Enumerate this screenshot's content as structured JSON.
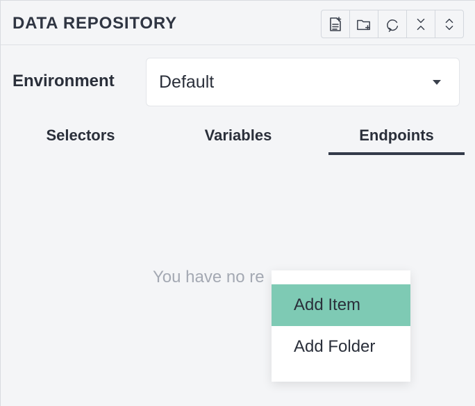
{
  "header": {
    "title": "DATA REPOSITORY",
    "tools": [
      {
        "icon": "new-file-icon"
      },
      {
        "icon": "new-folder-icon"
      },
      {
        "icon": "refresh-icon"
      },
      {
        "icon": "collapse-all-icon"
      },
      {
        "icon": "expand-all-icon"
      }
    ]
  },
  "environment": {
    "label": "Environment",
    "selected": "Default"
  },
  "tabs": [
    {
      "label": "Selectors",
      "active": false
    },
    {
      "label": "Variables",
      "active": false
    },
    {
      "label": "Endpoints",
      "active": true
    }
  ],
  "empty_state": {
    "text": "You have no re"
  },
  "context_menu": {
    "items": [
      {
        "label": "Add Item",
        "highlighted": true
      },
      {
        "label": "Add Folder",
        "highlighted": false
      }
    ]
  },
  "colors": {
    "menu_highlight": "#7ecab4",
    "active_tab_underline": "#333a4a"
  }
}
